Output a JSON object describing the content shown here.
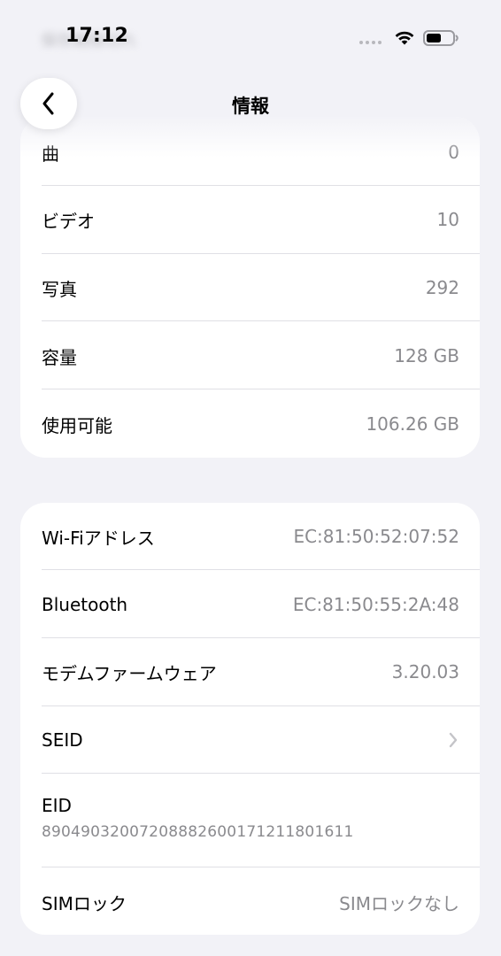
{
  "status_bar": {
    "time": "17:12",
    "blurred_text": "保存期限切れ"
  },
  "nav": {
    "title": "情報",
    "back_icon": "chevron-left-icon"
  },
  "section1": {
    "rows": [
      {
        "label": "曲",
        "value": "0"
      },
      {
        "label": "ビデオ",
        "value": "10"
      },
      {
        "label": "写真",
        "value": "292"
      },
      {
        "label": "容量",
        "value": "128 GB"
      },
      {
        "label": "使用可能",
        "value": "106.26 GB"
      }
    ]
  },
  "section2": {
    "rows": [
      {
        "label": "Wi-Fiアドレス",
        "value": "EC:81:50:52:07:52"
      },
      {
        "label": "Bluetooth",
        "value": "EC:81:50:55:2A:48"
      },
      {
        "label": "モデムファームウェア",
        "value": "3.20.03"
      },
      {
        "label": "SEID",
        "value": ""
      },
      {
        "label": "EID",
        "value": "89049032007208882600171211801611"
      },
      {
        "label": "SIMロック",
        "value": "SIMロックなし"
      }
    ]
  },
  "colors": {
    "background": "#f2f2f7",
    "card": "#ffffff",
    "secondary_text": "#8a8a8e",
    "separator": "#e0e0e5"
  }
}
